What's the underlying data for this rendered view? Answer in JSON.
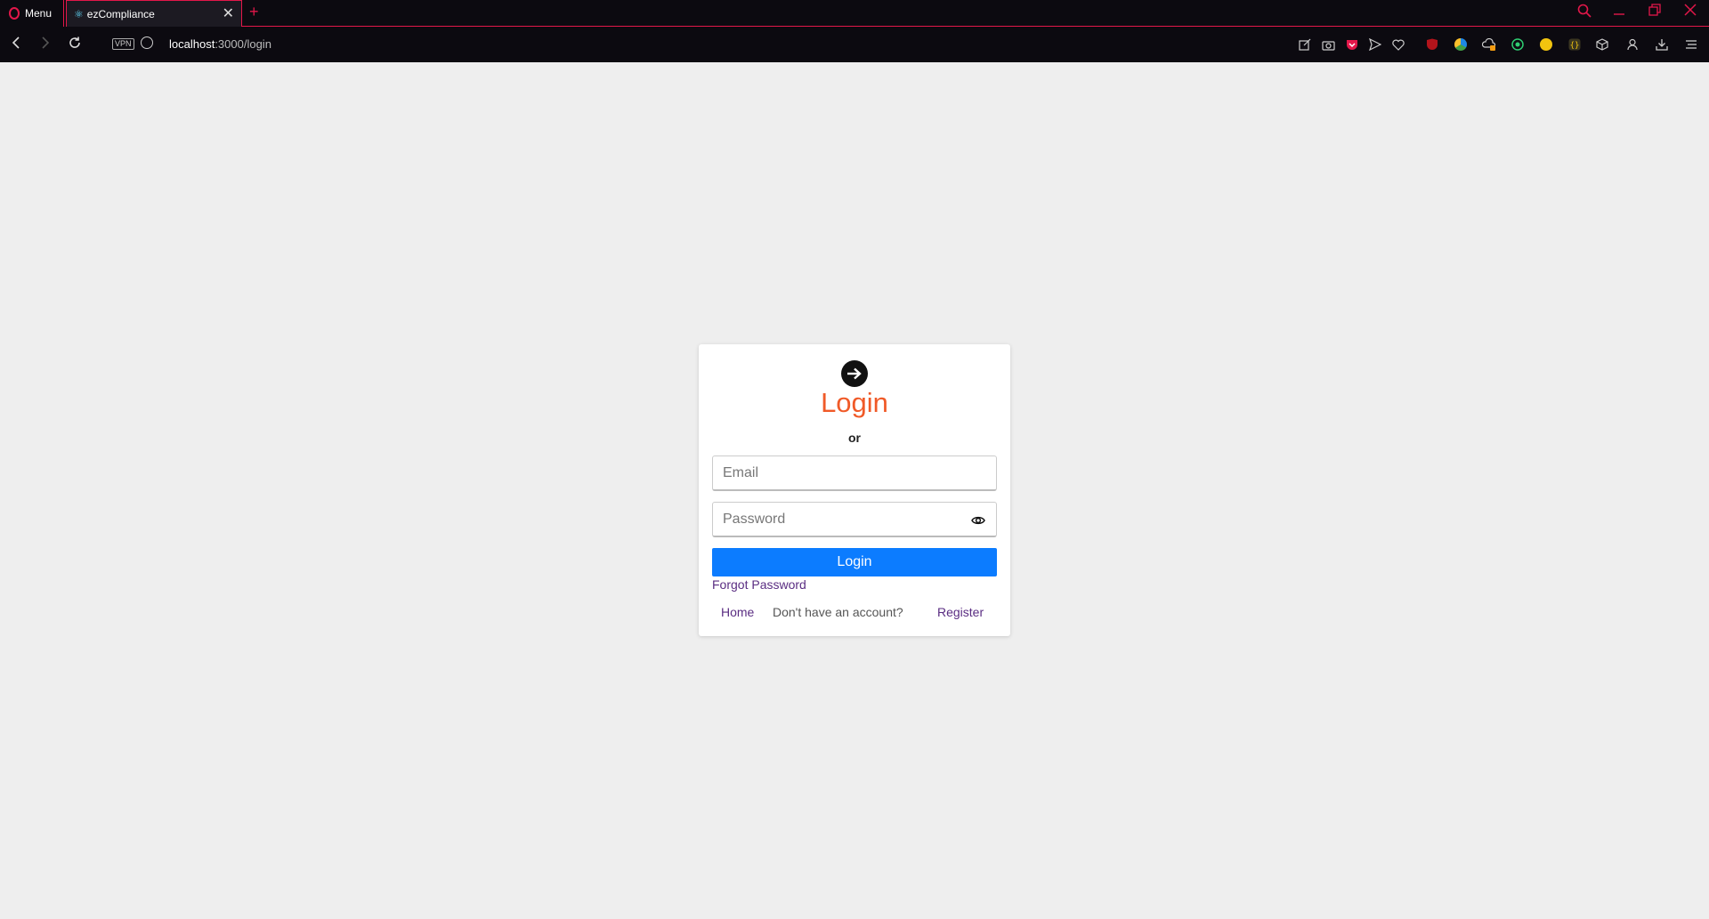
{
  "browser": {
    "menu_label": "Menu",
    "tab": {
      "title": "ezCompliance"
    },
    "new_tab_symbol": "+",
    "vpn_label": "VPN",
    "url_host": "localhost",
    "url_path": ":3000/login"
  },
  "icons": {
    "opera": "opera-logo-icon",
    "react_favicon": "react-favicon-icon",
    "close": "close-icon",
    "back": "back-arrow-icon",
    "forward": "forward-arrow-icon",
    "reload": "reload-icon",
    "globe": "globe-icon",
    "login": "arrow-right-circle-icon",
    "eye": "eye-icon"
  },
  "login": {
    "title": "Login",
    "or_text": "or",
    "email_placeholder": "Email",
    "password_placeholder": "Password",
    "button_label": "Login",
    "forgot_password": "Forgot Password",
    "home_link": "Home",
    "no_account_text": "Don't have an account?",
    "register_link": "Register"
  },
  "colors": {
    "title_accent": "#f05a28",
    "primary_button": "#0c7cff",
    "link": "#5a2d82",
    "browser_accent": "#e3174a",
    "page_background": "#eeeeee"
  }
}
